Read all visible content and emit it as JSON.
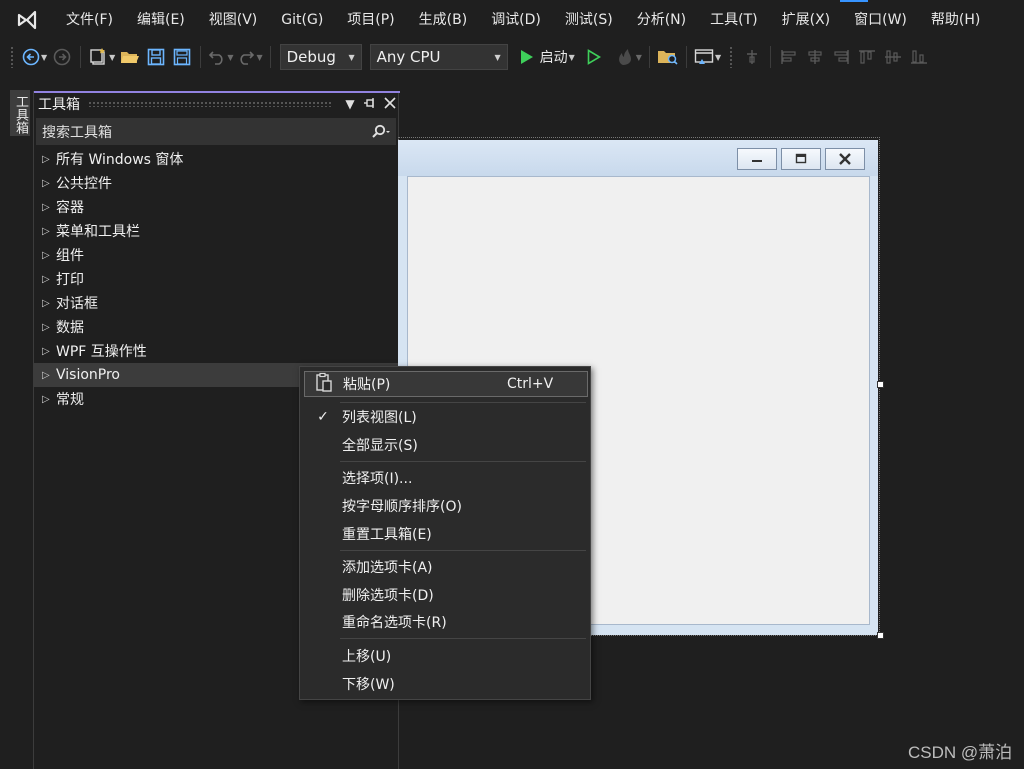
{
  "menubar": {
    "items": [
      "文件(F)",
      "编辑(E)",
      "视图(V)",
      "Git(G)",
      "项目(P)",
      "生成(B)",
      "调试(D)",
      "测试(S)",
      "分析(N)",
      "工具(T)",
      "扩展(X)",
      "窗口(W)",
      "帮助(H)"
    ]
  },
  "toolbar": {
    "configuration": "Debug",
    "platform": "Any CPU",
    "start_label": "启动"
  },
  "side_tab": {
    "label": "工具箱"
  },
  "toolbox": {
    "title": "工具箱",
    "search_placeholder": "搜索工具箱",
    "groups": [
      "所有 Windows 窗体",
      "公共控件",
      "容器",
      "菜单和工具栏",
      "组件",
      "打印",
      "对话框",
      "数据",
      "WPF 互操作性",
      "VisionPro",
      "常规"
    ],
    "selected_group": "VisionPro"
  },
  "context_menu": {
    "items": [
      {
        "label": "粘贴(P)",
        "shortcut": "Ctrl+V",
        "checked": false
      },
      {
        "label": "列表视图(L)",
        "shortcut": "",
        "checked": true
      },
      {
        "label": "全部显示(S)",
        "shortcut": "",
        "checked": false
      },
      {
        "label": "选择项(I)...",
        "shortcut": "",
        "checked": false
      },
      {
        "label": "按字母顺序排序(O)",
        "shortcut": "",
        "checked": false
      },
      {
        "label": "重置工具箱(E)",
        "shortcut": "",
        "checked": false
      },
      {
        "label": "添加选项卡(A)",
        "shortcut": "",
        "checked": false
      },
      {
        "label": "删除选项卡(D)",
        "shortcut": "",
        "checked": false
      },
      {
        "label": "重命名选项卡(R)",
        "shortcut": "",
        "checked": false
      },
      {
        "label": "上移(U)",
        "shortcut": "",
        "checked": false
      },
      {
        "label": "下移(W)",
        "shortcut": "",
        "checked": false
      }
    ],
    "check_mark": "✓"
  },
  "watermark": "CSDN @萧泊",
  "colors": {
    "background": "#1f1f1f",
    "accent_purple": "#9182e0",
    "accent_blue": "#3794ff",
    "run_green": "#3ecf5a"
  }
}
